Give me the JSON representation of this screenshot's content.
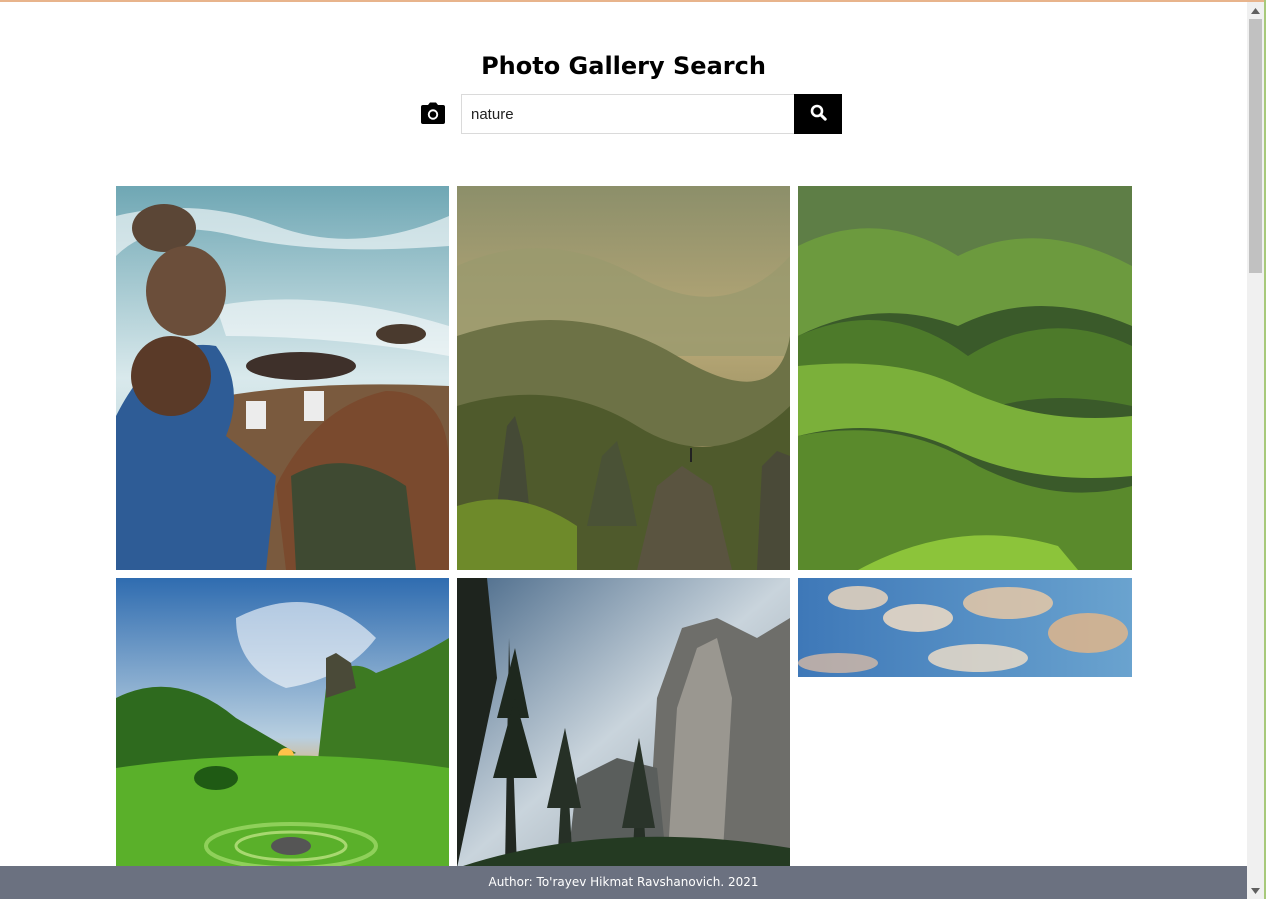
{
  "page": {
    "title": "Photo Gallery Search"
  },
  "search": {
    "value": "nature",
    "placeholder": ""
  },
  "icons": {
    "camera": "camera-icon",
    "search": "search-icon"
  },
  "gallery": {
    "photos": [
      "couple-on-coastal-rocks",
      "misty-mountain-peaks",
      "green-rolling-hills",
      "sunset-green-valley",
      "granite-cliff-pines",
      "sky-with-clouds"
    ]
  },
  "footer": {
    "text": "Author: To'rayev Hikmat Ravshanovich. 2021"
  },
  "colors": {
    "footer_bg": "#6b7180",
    "button_bg": "#000000"
  }
}
